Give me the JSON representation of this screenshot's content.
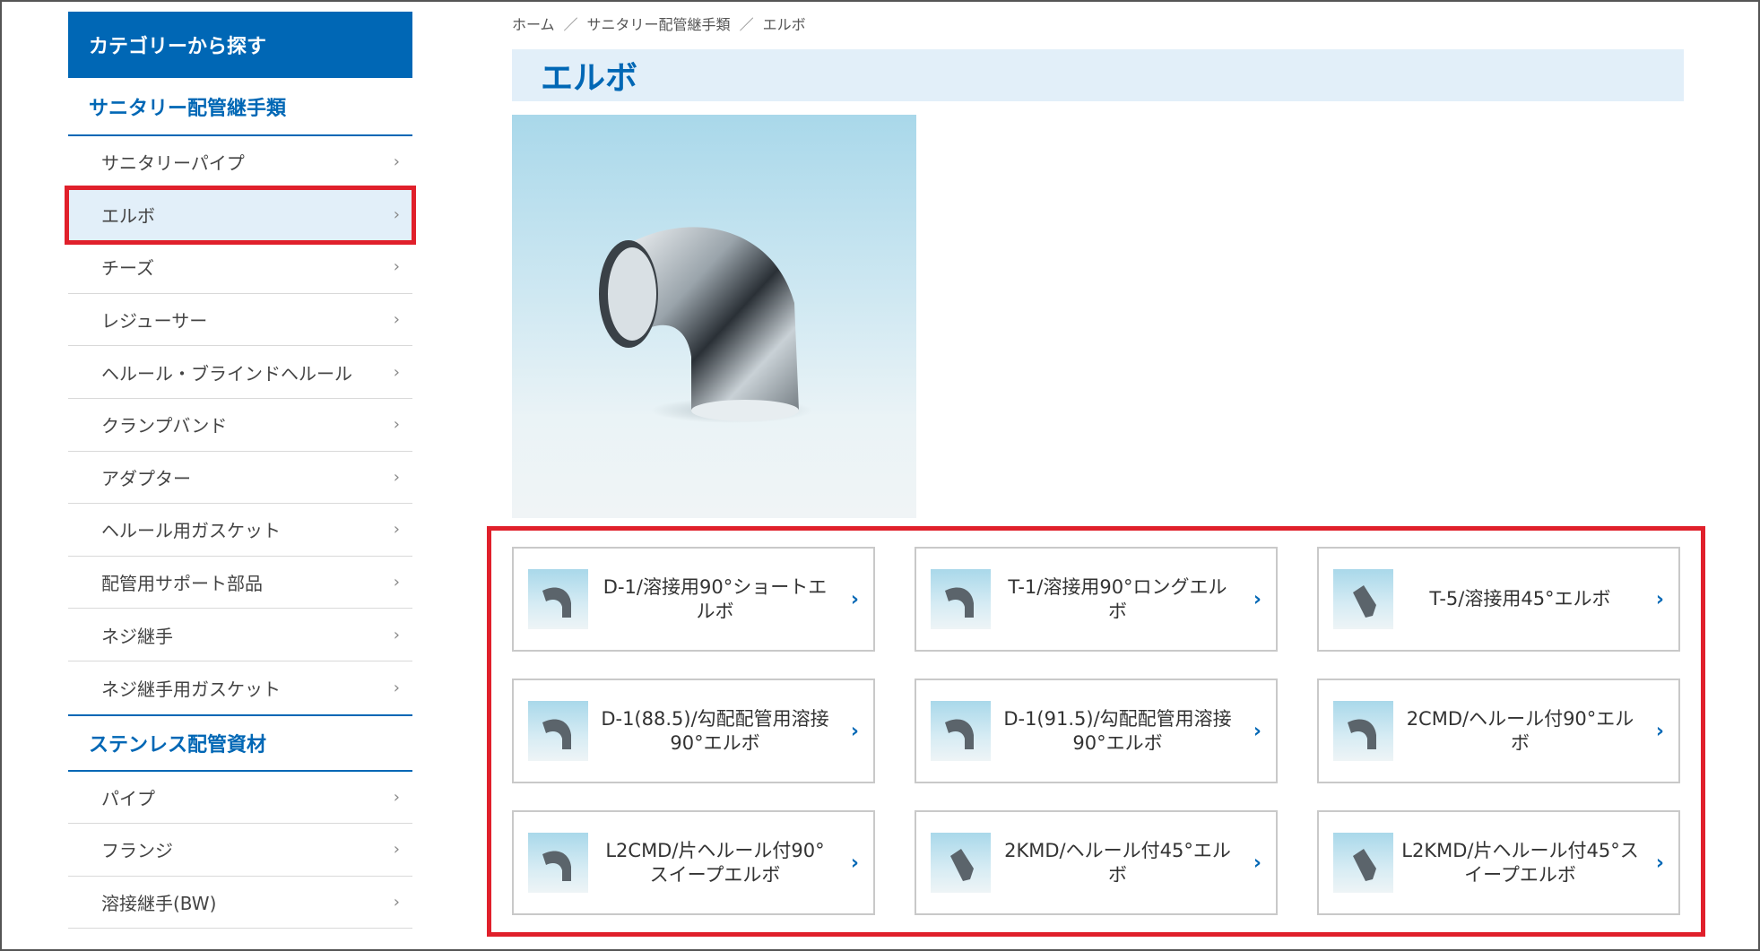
{
  "breadcrumb": [
    "ホーム",
    "サニタリー配管継手類",
    "エルボ"
  ],
  "breadcrumb_separator": "／",
  "page_title": "エルボ",
  "sidebar": {
    "header": "カテゴリーから探す",
    "group1_title": "サニタリー配管継手類",
    "group1_items": [
      {
        "label": "サニタリーパイプ",
        "active": false
      },
      {
        "label": "エルボ",
        "active": true
      },
      {
        "label": "チーズ",
        "active": false
      },
      {
        "label": "レジューサー",
        "active": false
      },
      {
        "label": "ヘルール・ブラインドヘルール",
        "active": false
      },
      {
        "label": "クランプバンド",
        "active": false
      },
      {
        "label": "アダプター",
        "active": false
      },
      {
        "label": "ヘルール用ガスケット",
        "active": false
      },
      {
        "label": "配管用サポート部品",
        "active": false
      },
      {
        "label": "ネジ継手",
        "active": false
      },
      {
        "label": "ネジ継手用ガスケット",
        "active": false
      }
    ],
    "group2_title": "ステンレス配管資材",
    "group2_items": [
      {
        "label": "パイプ"
      },
      {
        "label": "フランジ"
      },
      {
        "label": "溶接継手(BW)"
      }
    ],
    "chevron": "›"
  },
  "products": [
    {
      "label": "D-1/溶接用90°ショートエルボ",
      "angle": 90
    },
    {
      "label": "T-1/溶接用90°ロングエルボ",
      "angle": 90
    },
    {
      "label": "T-5/溶接用45°エルボ",
      "angle": 45
    },
    {
      "label": "D-1(88.5)/勾配配管用溶接90°エルボ",
      "angle": 90
    },
    {
      "label": "D-1(91.5)/勾配配管用溶接90°エルボ",
      "angle": 90
    },
    {
      "label": "2CMD/ヘルール付90°エルボ",
      "angle": 90
    },
    {
      "label": "L2CMD/片ヘルール付90°スイープエルボ",
      "angle": 90
    },
    {
      "label": "2KMD/ヘルール付45°エルボ",
      "angle": 45
    },
    {
      "label": "L2KMD/片ヘルール付45°スイープエルボ",
      "angle": 45
    }
  ],
  "product_chevron": "›",
  "colors": {
    "brand_blue": "#0067b5",
    "title_bg": "#e2eff9",
    "highlight_red": "#e0202b"
  }
}
